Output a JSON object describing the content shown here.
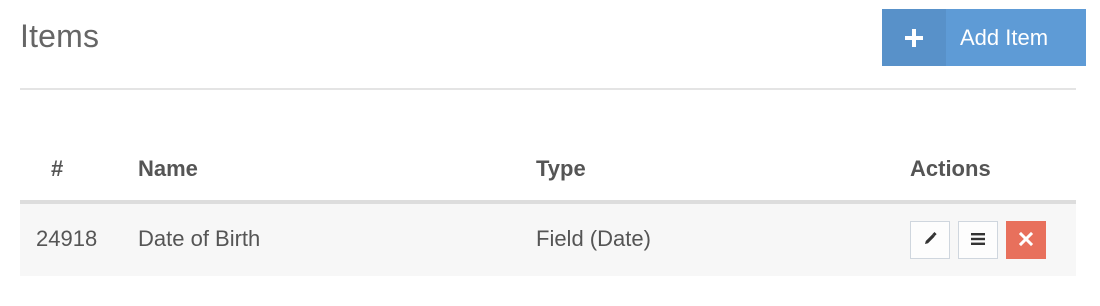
{
  "header": {
    "title": "Items",
    "add_button_label": "Add Item",
    "add_button_icon": "plus-icon"
  },
  "table": {
    "columns": [
      "#",
      "Name",
      "Type",
      "Actions"
    ],
    "rows": [
      {
        "id": "24918",
        "name": "Date of Birth",
        "type": "Field (Date)",
        "actions": [
          "pencil-icon",
          "list-icon",
          "close-icon"
        ]
      }
    ]
  },
  "colors": {
    "primary": "#5e9bd6",
    "danger": "#e8705c",
    "row_bg": "#f7f7f7"
  }
}
